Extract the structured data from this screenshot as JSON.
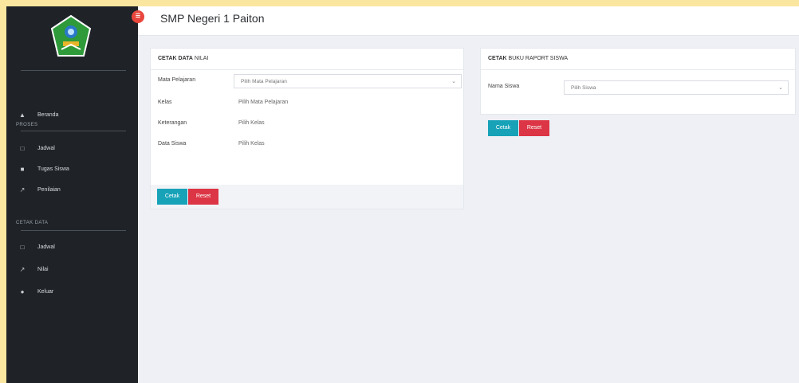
{
  "header": {
    "title": "SMP Negeri 1 Paiton",
    "toggle_icon": "hamburger-icon"
  },
  "sidebar": {
    "items": [
      {
        "label": "Beranda",
        "icon": "home-icon"
      }
    ],
    "section1": "PROSES",
    "proses_items": [
      {
        "label": "Jadwal",
        "icon": "calendar-icon"
      },
      {
        "label": "Tugas Siswa",
        "icon": "users-icon"
      },
      {
        "label": "Penilaian",
        "icon": "edit-icon"
      }
    ],
    "section2": "CETAK DATA",
    "cetak_items": [
      {
        "label": "Jadwal",
        "icon": "calendar-icon"
      },
      {
        "label": "Nilai",
        "icon": "edit-icon"
      },
      {
        "label": "Keluar",
        "icon": "power-icon"
      }
    ]
  },
  "card_nilai": {
    "title_bold": "CETAK DATA",
    "title_rest": " NILAI",
    "rows": [
      {
        "label": "Mata Pelajaran",
        "value": "Pilih Mata Pelajaran",
        "type": "select"
      },
      {
        "label": "Kelas",
        "value": "Pilih Mata Pelajaran",
        "type": "text"
      },
      {
        "label": "Keterangan",
        "value": "Pilih Kelas",
        "type": "text"
      },
      {
        "label": "Data Siswa",
        "value": "Pilih Kelas",
        "type": "text"
      }
    ],
    "btn_print": "Cetak",
    "btn_reset": "Reset"
  },
  "card_raport": {
    "title_bold": "CETAK",
    "title_rest": " BUKU RAPORT SISWA",
    "rows": [
      {
        "label": "Nama Siswa",
        "value": "Pilih Siswa",
        "type": "select"
      }
    ],
    "btn_print": "Cetak",
    "btn_reset": "Reset"
  }
}
